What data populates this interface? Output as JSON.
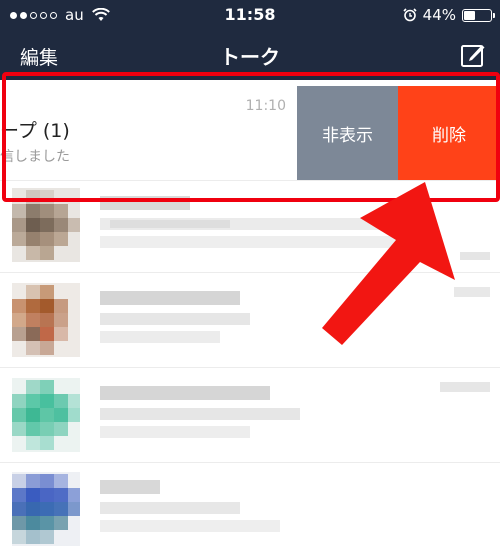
{
  "status_bar": {
    "carrier": "au",
    "time": "11:58",
    "battery_text": "44%",
    "battery_level": 0.44
  },
  "nav": {
    "edit_label": "編集",
    "title": "トーク"
  },
  "swiped_row": {
    "name": "ープ (1)",
    "message": "信しました",
    "time": "11:10",
    "hide_label": "非表示",
    "delete_label": "削除"
  },
  "colors": {
    "nav_bg": "#1f2a3f",
    "hide_bg": "#7d8897",
    "delete_bg": "#ff4218",
    "highlight": "#f0000f"
  }
}
